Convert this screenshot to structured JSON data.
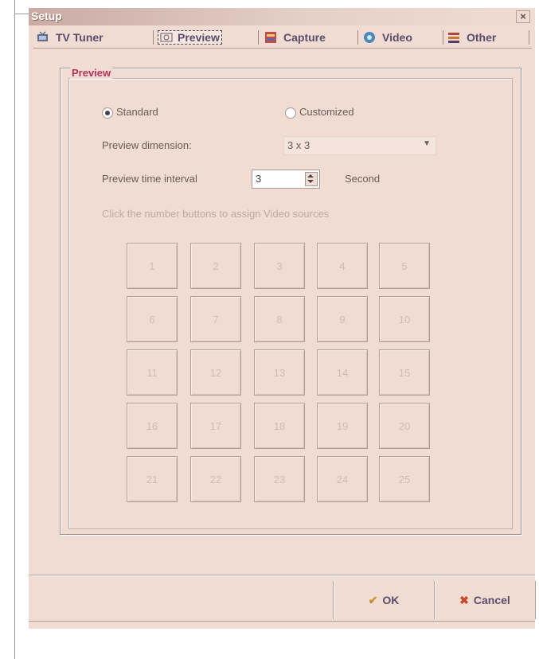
{
  "window": {
    "title": "Setup",
    "close_glyph": "×"
  },
  "tabs": [
    {
      "label": "TV Tuner",
      "icon": "tv-tuner-icon",
      "active": false
    },
    {
      "label": "Preview",
      "icon": "preview-icon",
      "active": true
    },
    {
      "label": "Capture",
      "icon": "capture-icon",
      "active": false
    },
    {
      "label": "Video",
      "icon": "video-icon",
      "active": false
    },
    {
      "label": "Other",
      "icon": "other-icon",
      "active": false
    }
  ],
  "preview": {
    "group_title": "Preview",
    "mode_standard": "Standard",
    "mode_customized": "Customized",
    "mode_selected": "Standard",
    "dimension_label": "Preview dimension:",
    "dimension_value": "3 x 3",
    "interval_label": "Preview time interval",
    "interval_value": "3",
    "interval_unit": "Second",
    "hint": "Click the number buttons to assign Video sources",
    "cells": [
      "1",
      "2",
      "3",
      "4",
      "5",
      "6",
      "7",
      "8",
      "9",
      "10",
      "11",
      "12",
      "13",
      "14",
      "15",
      "16",
      "17",
      "18",
      "19",
      "20",
      "21",
      "22",
      "23",
      "24",
      "25"
    ]
  },
  "footer": {
    "ok_label": "OK",
    "cancel_label": "Cancel"
  },
  "colors": {
    "window_bg": "#f0dcd2",
    "group_title": "#b2355a",
    "tab_text": "#5a4c6a"
  }
}
